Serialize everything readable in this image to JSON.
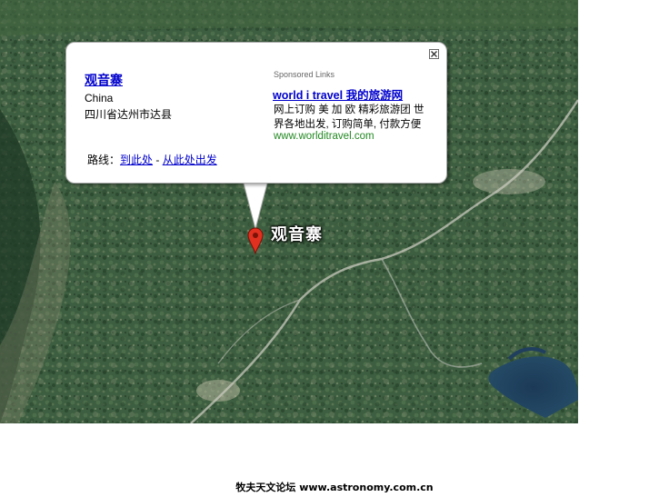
{
  "map": {
    "place_label": "观音寨"
  },
  "info_window": {
    "title": "观音寨",
    "address_line1": "China",
    "address_line2": "四川省达州市达县",
    "route_prefix": "路线：",
    "route_to": "到此处",
    "route_separator": " - ",
    "route_from": "从此处出发",
    "sponsored_label": "Sponsored Links",
    "ad_title": "world i travel 我的旅游网",
    "ad_desc_line1": "网上订购 美 加 欧 精彩旅游团 世",
    "ad_desc_line2": "界各地出发, 订购简单, 付款方便",
    "ad_url": "www.worlditravel.com"
  },
  "footer": {
    "text": "牧夫天文论坛 www.astronomy.com.cn"
  },
  "colors": {
    "link": "#0000cc",
    "ad_url": "#228822",
    "map_base": "#35533a",
    "marker": "#e03020"
  }
}
